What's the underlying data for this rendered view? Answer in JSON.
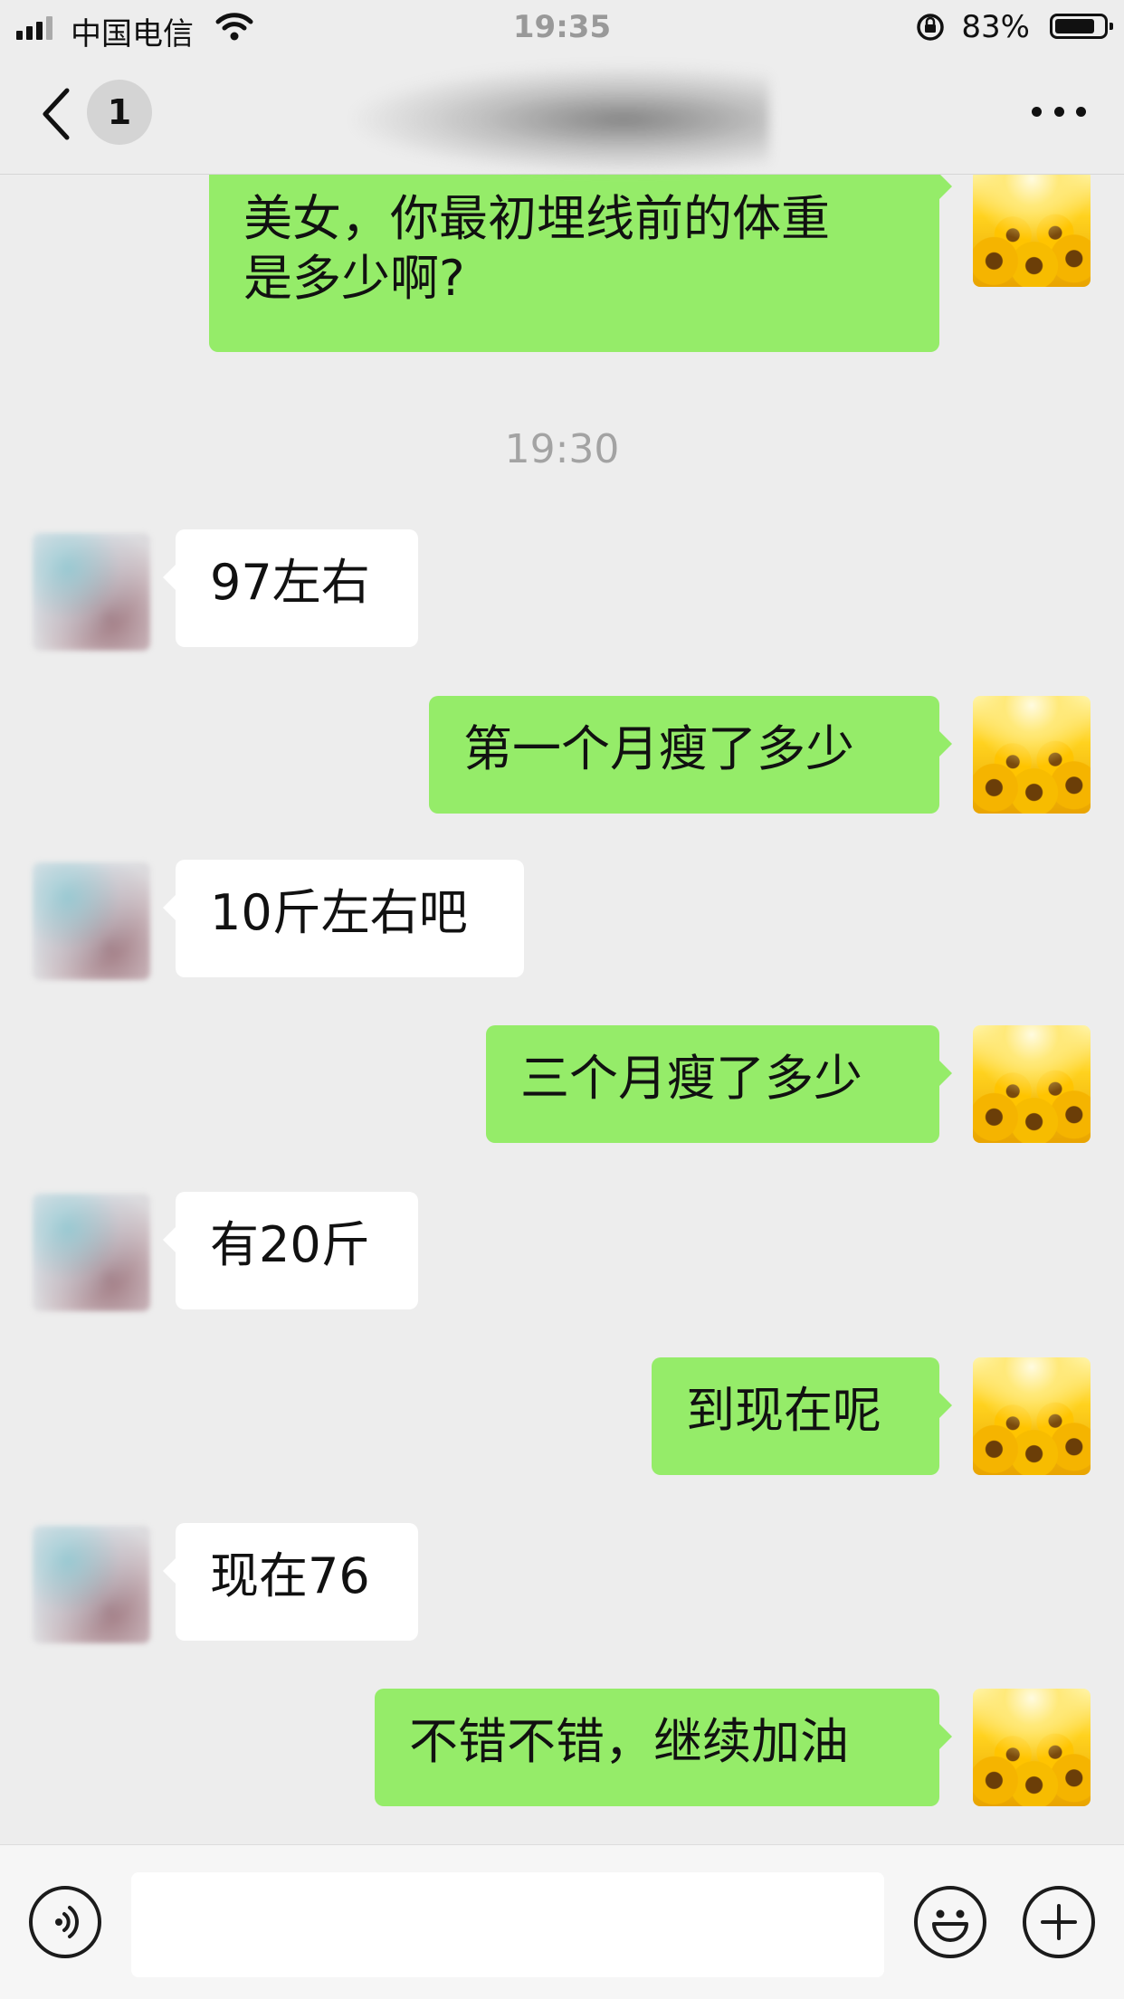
{
  "status_bar": {
    "carrier": "中国电信",
    "time": "19:35",
    "battery_percent": "83%",
    "battery_level": 0.83
  },
  "nav": {
    "unread_count": "1",
    "title": ""
  },
  "messages": [
    {
      "side": "sent",
      "text_line1": "美女，你最初埋线前的体重",
      "text_line2": "是多少啊?"
    },
    {
      "type": "timestamp",
      "text": "19:30"
    },
    {
      "side": "recv",
      "text": "97左右"
    },
    {
      "side": "sent",
      "text": "第一个月瘦了多少"
    },
    {
      "side": "recv",
      "text": "10斤左右吧"
    },
    {
      "side": "sent",
      "text": "三个月瘦了多少"
    },
    {
      "side": "recv",
      "text": "有20斤"
    },
    {
      "side": "sent",
      "text": "到现在呢"
    },
    {
      "side": "recv",
      "text": "现在76"
    },
    {
      "side": "sent",
      "text": "不错不错，继续加油"
    }
  ],
  "input_bar": {
    "value": "",
    "placeholder": ""
  },
  "icons": {
    "back": "chevron-left-icon",
    "more": "more-horizontal-icon",
    "voice": "voice-icon",
    "emoji": "emoji-icon",
    "plus": "plus-icon"
  }
}
